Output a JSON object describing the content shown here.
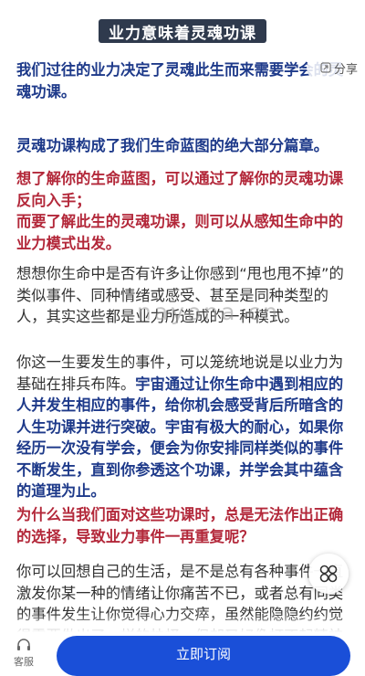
{
  "title": "业力意味着灵魂功课",
  "share_label": "分享",
  "p1": "我们过往的业力决定了灵魂此生而来需要学会的灵魂功课。",
  "p2": "灵魂功课构成了我们生命蓝图的绝大部分篇章。",
  "p3": "想了解你的生命蓝图，可以通过了解你的灵魂功课反向入手；",
  "p4": "而要了解此生的灵魂功课，则可以从感知生命中的业力模式出发。",
  "p5": "想想你生命中是否有许多让你感到“甩也甩不掉”的类似事件、同种情绪或感受、甚至是同种类型的人，其实这些都是业力所造成的一种模式。",
  "p6_plain": "你这一生要发生的事件，可以笼统地说是以业力为基础在排兵布阵。",
  "p6_bold": "宇宙通过让你生命中遇到相应的人并发生相应的事件，给你机会感受背后所暗含的人生功课并进行突破。宇宙有极大的耐心，如果你经历一次没有学会，便会为你安排同样类似的事件不断发生，直到你参透这个功课，并学会其中蕴含的道理为止。",
  "p7": "为什么当我们面对这些功课时，总是无法作出正确的选择，导致业力事件一再重复呢？",
  "p8": "你可以回想自己的生活，是不是总有各种事件一直激发你某一种的情绪让你痛苦不已，或者总有同类的事件发生让你觉得心力交瘁，虽然能隐隐约约觉得需要做出了一样的抉择，但却又好像打不起精神",
  "watermark": "nayona.cn",
  "customer_service_label": "客服",
  "subscribe_label": "立即订阅",
  "colors": {
    "accent": "#1a4fd8",
    "heading_blue": "#1e3a8a",
    "heading_red": "#b3283a",
    "banner": "#2f3a4d"
  }
}
